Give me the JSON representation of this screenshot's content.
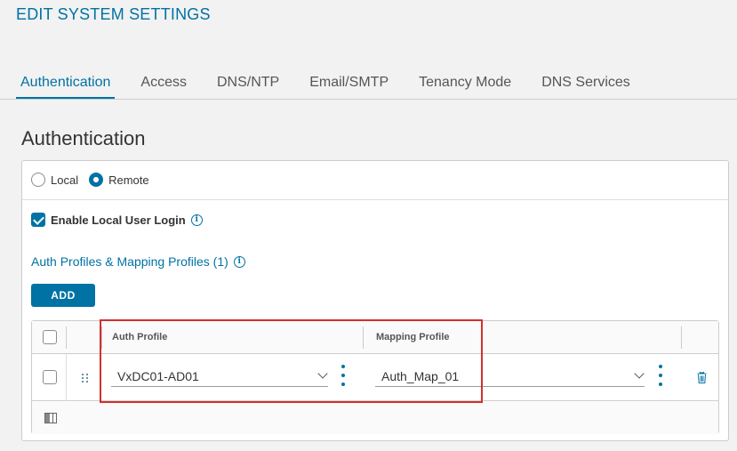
{
  "page": {
    "title": "EDIT SYSTEM SETTINGS"
  },
  "tabs": [
    {
      "label": "Authentication",
      "active": true
    },
    {
      "label": "Access",
      "active": false
    },
    {
      "label": "DNS/NTP",
      "active": false
    },
    {
      "label": "Email/SMTP",
      "active": false
    },
    {
      "label": "Tenancy Mode",
      "active": false
    },
    {
      "label": "DNS Services",
      "active": false
    }
  ],
  "section": {
    "title": "Authentication"
  },
  "auth_mode": {
    "options": [
      {
        "label": "Local",
        "selected": false
      },
      {
        "label": "Remote",
        "selected": true
      }
    ]
  },
  "local_login": {
    "label": "Enable Local User Login",
    "checked": true
  },
  "profiles": {
    "title": "Auth Profiles & Mapping Profiles (1)",
    "add_label": "ADD",
    "columns": {
      "auth_profile": "Auth Profile",
      "mapping_profile": "Mapping Profile"
    },
    "rows": [
      {
        "auth_profile": "VxDC01-AD01",
        "mapping_profile": "Auth_Map_01"
      }
    ]
  },
  "colors": {
    "accent": "#0072a3",
    "highlight": "#d0312d",
    "background": "#f2f2f2"
  },
  "icons": {
    "info": "info-icon",
    "kebab": "kebab-menu-icon",
    "trash": "trash-icon",
    "drag": "drag-handle-icon",
    "columns": "column-toggle-icon",
    "chevron": "chevron-down-icon"
  }
}
